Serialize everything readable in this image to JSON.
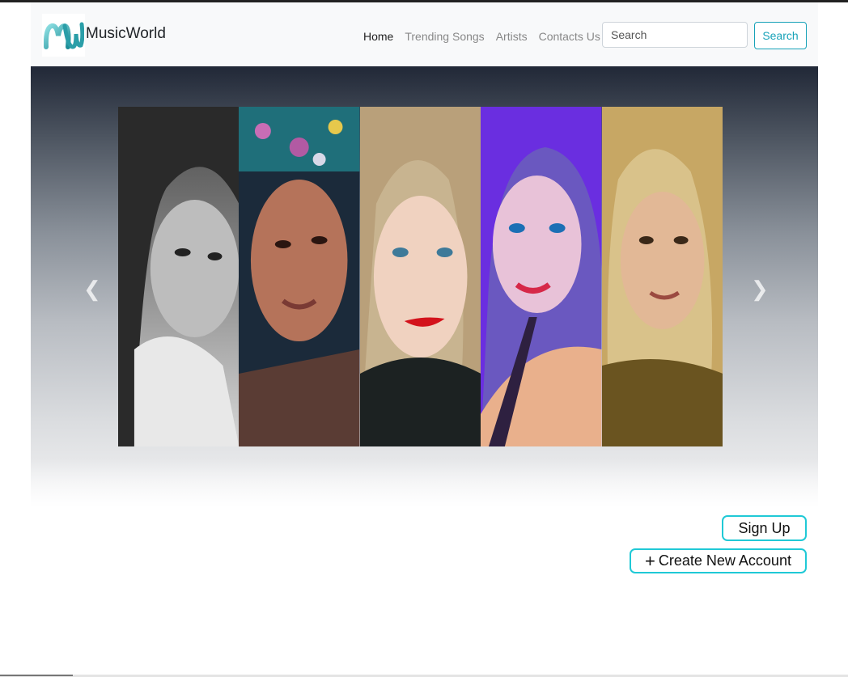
{
  "brand": {
    "name": "MusicWorld",
    "logo_icon": "mw-logo-icon",
    "logo_text": "MW"
  },
  "nav": {
    "items": [
      {
        "label": "Home",
        "active": true
      },
      {
        "label": "Trending Songs",
        "active": false
      },
      {
        "label": "Artists",
        "active": false
      },
      {
        "label": "Contacts Us",
        "active": false
      }
    ]
  },
  "search": {
    "placeholder": "Search",
    "button_label": "Search"
  },
  "carousel": {
    "prev_icon": "chevron-left-icon",
    "next_icon": "chevron-right-icon",
    "panels": [
      "artist-portrait-1",
      "artist-portrait-2",
      "artist-portrait-3",
      "artist-portrait-4",
      "artist-portrait-5"
    ]
  },
  "actions": {
    "signup_label": "Sign Up",
    "create_label": "Create New Account",
    "create_icon": "plus-icon"
  },
  "colors": {
    "accent": "#17a2b8",
    "button_border": "#20c9d6",
    "navbar_bg": "#f8f9fa"
  }
}
